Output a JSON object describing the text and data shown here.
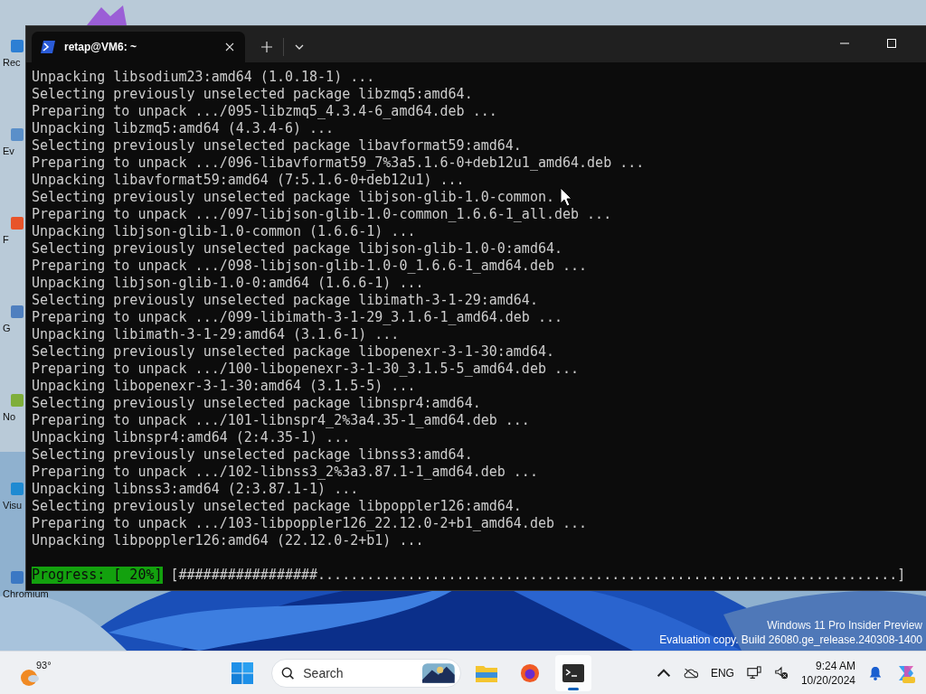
{
  "desktop": {
    "icons": [
      {
        "label": "Rec",
        "color": "#2d7fd4"
      },
      {
        "label": "Ev",
        "color": "#5a8fc9"
      },
      {
        "label": "F",
        "color": "#e8542a"
      },
      {
        "label": "G",
        "color": "#4f7fbf"
      },
      {
        "label": "No",
        "color": "#7fae3a"
      },
      {
        "label": "Visu",
        "color": "#1f8ad2"
      },
      {
        "label": "Chromium",
        "color": "#3b78c4"
      }
    ],
    "watermark": [
      "Windows 11 Pro Insider Preview",
      "Evaluation copy. Build 26080.ge_release.240308-1400"
    ]
  },
  "window": {
    "tab": {
      "title": "retap@VM6: ~",
      "selected": true
    },
    "lines": [
      "Unpacking libsodium23:amd64 (1.0.18-1) ...",
      "Selecting previously unselected package libzmq5:amd64.",
      "Preparing to unpack .../095-libzmq5_4.3.4-6_amd64.deb ...",
      "Unpacking libzmq5:amd64 (4.3.4-6) ...",
      "Selecting previously unselected package libavformat59:amd64.",
      "Preparing to unpack .../096-libavformat59_7%3a5.1.6-0+deb12u1_amd64.deb ...",
      "Unpacking libavformat59:amd64 (7:5.1.6-0+deb12u1) ...",
      "Selecting previously unselected package libjson-glib-1.0-common.",
      "Preparing to unpack .../097-libjson-glib-1.0-common_1.6.6-1_all.deb ...",
      "Unpacking libjson-glib-1.0-common (1.6.6-1) ...",
      "Selecting previously unselected package libjson-glib-1.0-0:amd64.",
      "Preparing to unpack .../098-libjson-glib-1.0-0_1.6.6-1_amd64.deb ...",
      "Unpacking libjson-glib-1.0-0:amd64 (1.6.6-1) ...",
      "Selecting previously unselected package libimath-3-1-29:amd64.",
      "Preparing to unpack .../099-libimath-3-1-29_3.1.6-1_amd64.deb ...",
      "Unpacking libimath-3-1-29:amd64 (3.1.6-1) ...",
      "Selecting previously unselected package libopenexr-3-1-30:amd64.",
      "Preparing to unpack .../100-libopenexr-3-1-30_3.1.5-5_amd64.deb ...",
      "Unpacking libopenexr-3-1-30:amd64 (3.1.5-5) ...",
      "Selecting previously unselected package libnspr4:amd64.",
      "Preparing to unpack .../101-libnspr4_2%3a4.35-1_amd64.deb ...",
      "Unpacking libnspr4:amd64 (2:4.35-1) ...",
      "Selecting previously unselected package libnss3:amd64.",
      "Preparing to unpack .../102-libnss3_2%3a3.87.1-1_amd64.deb ...",
      "Unpacking libnss3:amd64 (2:3.87.1-1) ...",
      "Selecting previously unselected package libpoppler126:amd64.",
      "Preparing to unpack .../103-libpoppler126_22.12.0-2+b1_amd64.deb ...",
      "Unpacking libpoppler126:amd64 (22.12.0-2+b1) ..."
    ],
    "progress": {
      "label": "Progress: [ 20%]",
      "bar": "[#################.......................................................................]"
    }
  },
  "taskbar": {
    "weather": "93°",
    "search": {
      "placeholder": "Search"
    },
    "apps": [
      {
        "kind": "explorer",
        "selected": false
      },
      {
        "kind": "firefox",
        "selected": false
      },
      {
        "kind": "terminal",
        "selected": true
      }
    ],
    "language": "ENG",
    "time": "9:24 AM",
    "date": "10/20/2024"
  }
}
